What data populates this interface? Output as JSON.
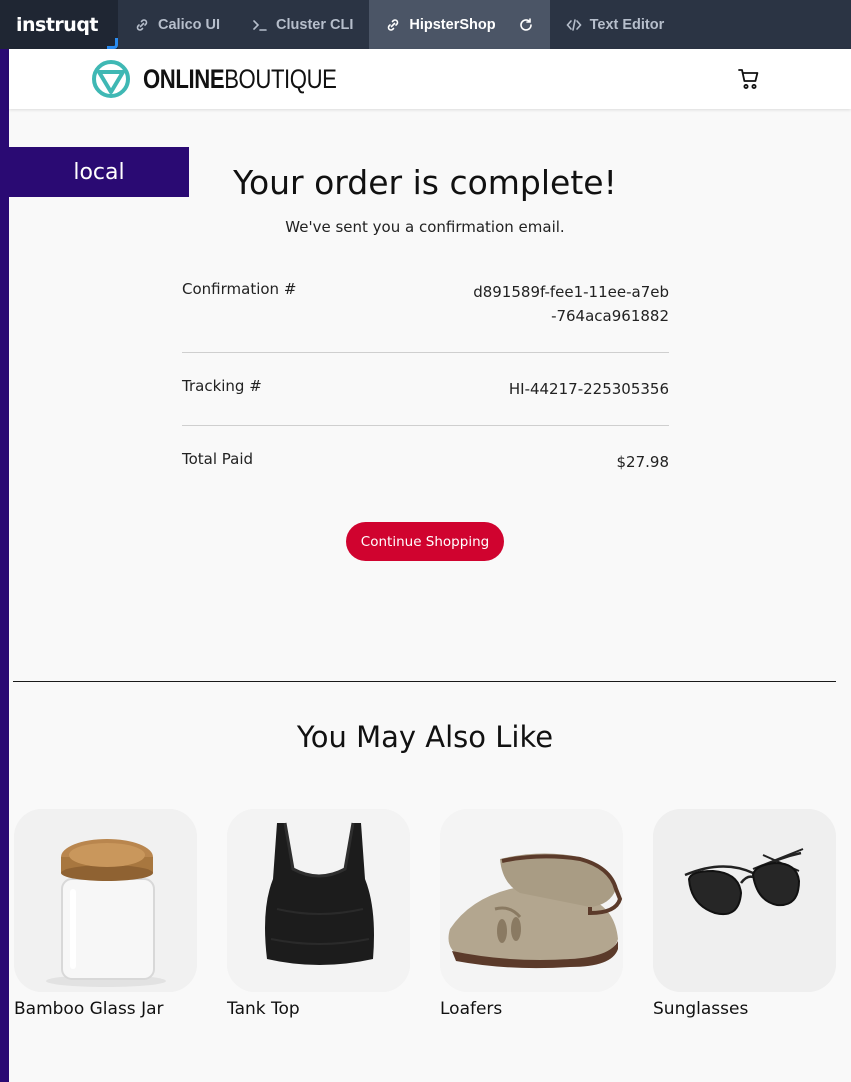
{
  "topbar": {
    "brand": "instruqt",
    "tabs": [
      {
        "label": "Calico UI",
        "icon": "link-icon",
        "active": false
      },
      {
        "label": "Cluster CLI",
        "icon": "terminal-icon",
        "active": false
      },
      {
        "label": "HipsterShop",
        "icon": "link-icon",
        "active": true
      },
      {
        "label": "Text Editor",
        "icon": "code-icon",
        "active": false
      }
    ]
  },
  "header": {
    "logo_strong": "ONLINE",
    "logo_light": "BOUTIQUE"
  },
  "badge": {
    "label": "local"
  },
  "order": {
    "title": "Your order is complete!",
    "subtitle": "We've sent you a confirmation email.",
    "rows": [
      {
        "label": "Confirmation #",
        "value": "d891589f-fee1-11ee-a7eb-764aca961882"
      },
      {
        "label": "Tracking #",
        "value": "HI-44217-225305356"
      },
      {
        "label": "Total Paid",
        "value": "$27.98"
      }
    ],
    "continue_label": "Continue Shopping"
  },
  "recommendations": {
    "title": "You May Also Like",
    "items": [
      {
        "name": "Bamboo Glass Jar"
      },
      {
        "name": "Tank Top"
      },
      {
        "name": "Loafers"
      },
      {
        "name": "Sunglasses"
      }
    ]
  },
  "colors": {
    "accent": "#d0032f",
    "badge": "#2a0a73",
    "topbar": "#2b3444",
    "logo_teal": "#3fb8b4"
  }
}
